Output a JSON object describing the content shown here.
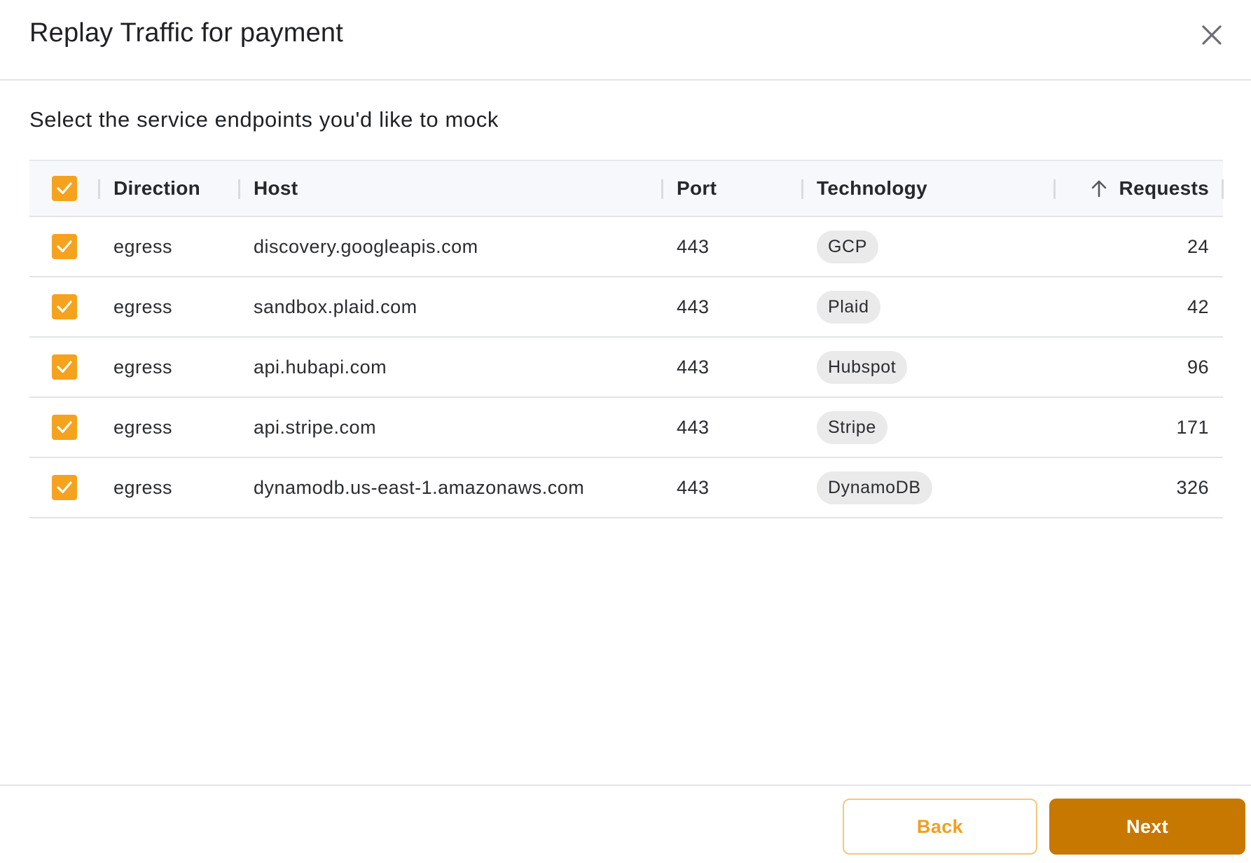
{
  "dialog": {
    "title": "Replay Traffic for payment"
  },
  "subtitle": "Select the service endpoints you'd like to mock",
  "table": {
    "columns": {
      "direction": "Direction",
      "host": "Host",
      "port": "Port",
      "technology": "Technology",
      "requests": "Requests"
    },
    "rows": [
      {
        "direction": "egress",
        "host": "discovery.googleapis.com",
        "port": "443",
        "technology": "GCP",
        "requests": "24"
      },
      {
        "direction": "egress",
        "host": "sandbox.plaid.com",
        "port": "443",
        "technology": "Plaid",
        "requests": "42"
      },
      {
        "direction": "egress",
        "host": "api.hubapi.com",
        "port": "443",
        "technology": "Hubspot",
        "requests": "96"
      },
      {
        "direction": "egress",
        "host": "api.stripe.com",
        "port": "443",
        "technology": "Stripe",
        "requests": "171"
      },
      {
        "direction": "egress",
        "host": "dynamodb.us-east-1.amazonaws.com",
        "port": "443",
        "technology": "DynamoDB",
        "requests": "326"
      }
    ]
  },
  "footer": {
    "back_label": "Back",
    "next_label": "Next"
  },
  "colors": {
    "accent": "#f5a21e",
    "primary_button": "#c77800",
    "badge_bg": "#eaeaea"
  },
  "icons": {
    "close": "close-icon",
    "check": "check-icon",
    "sort": "arrow-up-icon"
  }
}
